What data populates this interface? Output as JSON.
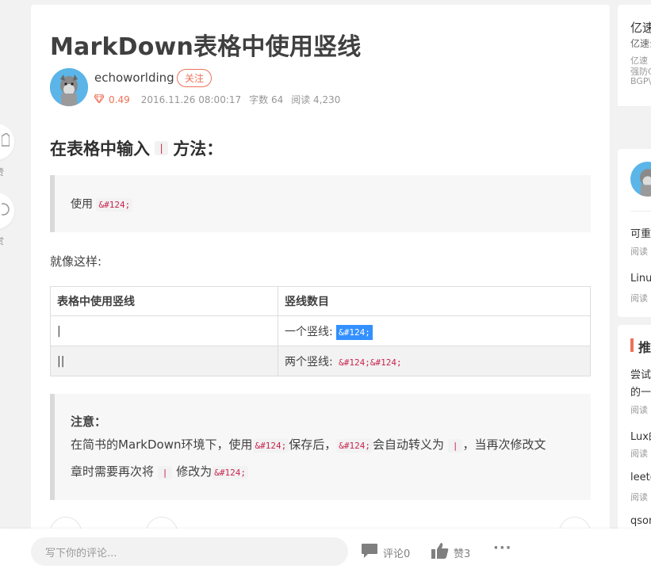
{
  "left_actions": {
    "like_label": "赞",
    "reward_label": "赏"
  },
  "article": {
    "title": "MarkDown表格中使用竖线",
    "author": "echoworlding",
    "follow_label": "关注",
    "diamond": "0.49",
    "date": "2016.11.26 08:00:17",
    "word_count": "字数 64",
    "read_count": "阅读 4,230",
    "heading_pre": "在表格中输入",
    "heading_code": "|",
    "heading_post": "方法：",
    "quote1_pre": "使用",
    "quote1_code": "&#124;",
    "para": "就像这样:",
    "table": {
      "headers": [
        "表格中使用竖线",
        "竖线数目"
      ],
      "row1_col1": "|",
      "row1_col2_text": "一个竖线:",
      "row1_col2_code": "&#124;",
      "row2_col1": "||",
      "row2_col2_text": "两个竖线:",
      "row2_col2_code": "&#124;&#124;"
    },
    "note_title": "注意：",
    "note_p1": "在简书的MarkDown环境下，使用",
    "note_c1": "&#124;",
    "note_p2": "保存后，",
    "note_c2": "&#124;",
    "note_p3": "会自动转义为",
    "note_c3": "|",
    "note_p4": "，当再次修改文",
    "note_p5": "章时需要再次将",
    "note_c4": "|",
    "note_p6": "修改为",
    "note_c5": "&#124;"
  },
  "bottom_bar": {
    "comment_placeholder": "写下你的评论...",
    "comment_label": "评论0",
    "like_label": "赞3",
    "more_label": "···"
  },
  "sidebar": {
    "ad_title": "亿速",
    "ad_sub": "亿速云",
    "ad_line1": "亿速",
    "ad_line2": "强防C",
    "ad_line3": "BGP\\",
    "item1_title": "可重",
    "item1_read": "阅读",
    "item2_title": "Linu",
    "item2_read": "阅读",
    "rec_header": "推",
    "rec1_title_a": "尝试",
    "rec1_title_b": "的一",
    "rec1_read": "阅读",
    "rec2_title": "Lux的",
    "rec2_read": "阅读",
    "rec3_title": "leetc",
    "rec3_read": "阅读",
    "rec4_title": "qson"
  },
  "colors": {
    "accent": "#ec7259",
    "code_red": "#c7254e",
    "selection": "#3390ff"
  }
}
